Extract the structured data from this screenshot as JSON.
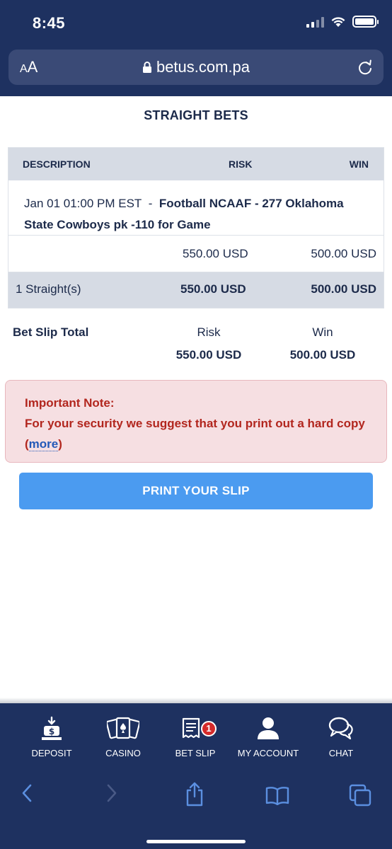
{
  "status_bar": {
    "time": "8:45"
  },
  "browser": {
    "url": "betus.com.pa",
    "aa_label_big": "A",
    "aa_label_small": "A"
  },
  "page": {
    "title": "STRAIGHT BETS"
  },
  "bet_table": {
    "headers": {
      "description": "DESCRIPTION",
      "risk": "RISK",
      "win": "WIN"
    },
    "bet": {
      "date": "Jan 01 01:00 PM EST",
      "separator": "-",
      "detail": "Football NCAAF - 277 Oklahoma State Cowboys pk -110 for Game",
      "risk": "550.00 USD",
      "win": "500.00 USD"
    },
    "summary": {
      "label": "1 Straight(s)",
      "risk": "550.00 USD",
      "win": "500.00 USD"
    }
  },
  "slip_total": {
    "label": "Bet Slip Total",
    "risk_label": "Risk",
    "risk_value": "550.00 USD",
    "win_label": "Win",
    "win_value": "500.00 USD"
  },
  "note": {
    "title": "Important Note:",
    "text": "For your security we suggest that you print out a hard copy",
    "open_paren": "(",
    "link": "more",
    "close_paren": ")"
  },
  "print_button": {
    "label": "PRINT YOUR SLIP"
  },
  "site_nav": {
    "items": [
      {
        "label": "DEPOSIT",
        "icon": "deposit-icon"
      },
      {
        "label": "CASINO",
        "icon": "casino-cards-icon"
      },
      {
        "label": "BET SLIP",
        "icon": "bet-slip-icon",
        "badge": "1"
      },
      {
        "label": "MY ACCOUNT",
        "icon": "user-icon"
      },
      {
        "label": "CHAT",
        "icon": "chat-icon"
      }
    ]
  },
  "colors": {
    "navy": "#1e3160",
    "header_gray": "#d6dbe4",
    "note_bg": "#f6dfe2",
    "note_text": "#b2261e",
    "button_blue": "#4b9bf0",
    "badge_red": "#d42b2b"
  }
}
